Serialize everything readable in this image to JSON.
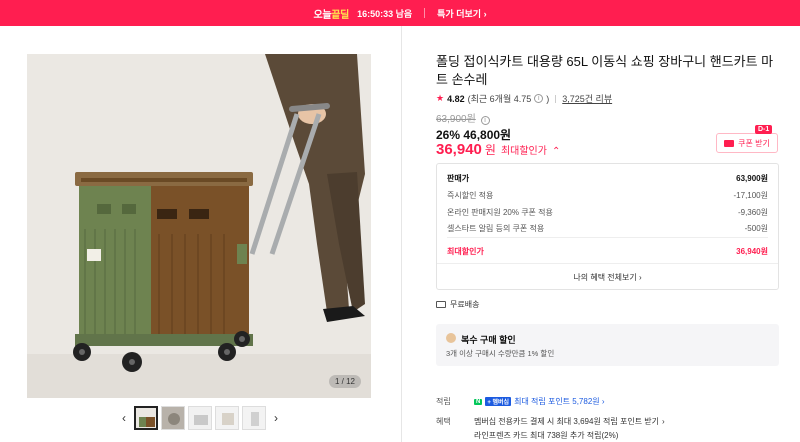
{
  "banner": {
    "brand_prefix": "오늘",
    "brand_suffix": "끝딜",
    "timer": "16:50:33 남음",
    "more_label": "특가 더보기"
  },
  "gallery": {
    "counter": "1 / 12",
    "thumbnail_count": 5
  },
  "product": {
    "title": "폴딩 접이식카트 대용량 65L 이동식 쇼핑 장바구니 핸드카트 마트 손수레",
    "rating": "4.82",
    "rating_detail": "(최근 6개월 4.75",
    "rating_close": ")",
    "reviews": "3,725건 리뷰",
    "original_price": "63,900원",
    "discount_price": "26% 46,800원",
    "best_price": "36,940",
    "best_unit": "원",
    "best_label": "최대할인가",
    "coupon_label": "쿠폰 받기",
    "coupon_dday": "D-1"
  },
  "price_table": {
    "rows": [
      {
        "label": "판매가",
        "value": "63,900원"
      },
      {
        "label": "즉시할인 적용",
        "value": "-17,100원"
      },
      {
        "label": "온라인 판매지원 20% 쿠폰 적용",
        "value": "-9,360원"
      },
      {
        "label": "셀스타트 알림 등의 쿠폰 적용",
        "value": "-500원"
      }
    ],
    "total_label": "최대할인가",
    "total_value": "36,940원",
    "benefit_link": "나의 혜택 전체보기"
  },
  "shipping": {
    "label": "무료배송"
  },
  "multibuy": {
    "title": "복수 구매 할인",
    "desc": "3개 이상 구매시 수량만큼 1% 할인"
  },
  "points": {
    "label": "적립",
    "badge_n": "N",
    "badge_pay": "+ 멤버십",
    "main": "최대 적립 포인트 5,782원",
    "benefit_label": "혜택",
    "line1": "멤버십 전용카드 결제 시 최대 3,694원 적립 포인트 받기",
    "line2": "라인프렌즈 카드 최대 738원 추가 적립(2%)"
  },
  "colors": {
    "accent": "#ff1e50",
    "link": "#1c5be0"
  }
}
